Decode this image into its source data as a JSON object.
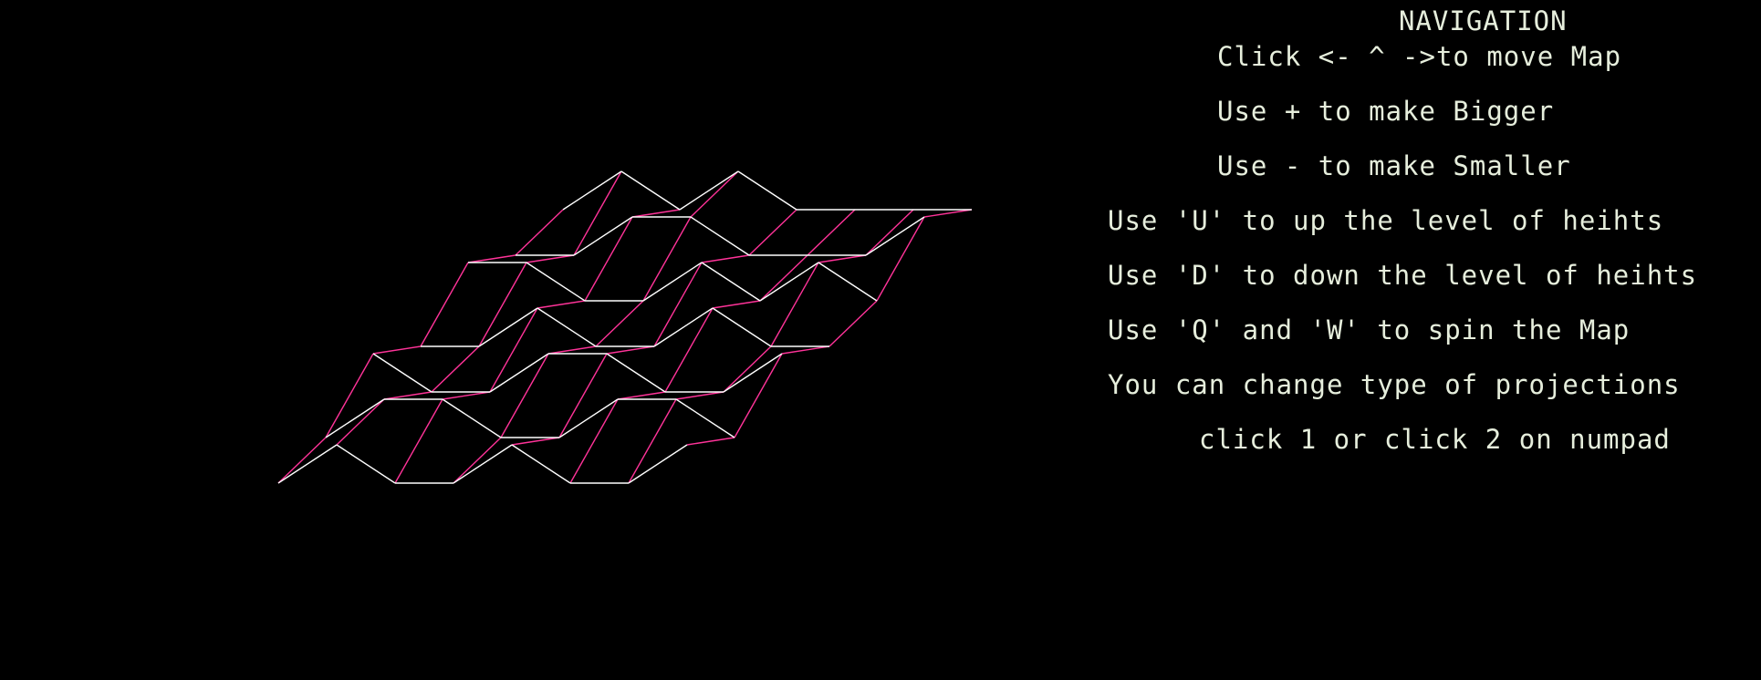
{
  "navigation": {
    "title": "NAVIGATION",
    "lines": [
      "Click <- ^ ->to move Map",
      "Use + to make Bigger",
      "Use - to make Smaller",
      "Use 'U' to up the level of heihts",
      "Use 'D' to down the level of heihts",
      "Use 'Q' and 'W' to spin the Map",
      "You can change type of projections",
      "click 1 or click 2 on numpad"
    ]
  },
  "map": {
    "colors": {
      "background": "#000000",
      "row_edges": "#ffffff",
      "column_edges": "#ff3399",
      "help_text": "#e6eedc"
    },
    "grid_rows": 7,
    "grid_cols": 8,
    "heights": [
      [
        0,
        1,
        0,
        0,
        1,
        0,
        0,
        1
      ],
      [
        0,
        1,
        1,
        0,
        0,
        1,
        1,
        0
      ],
      [
        1,
        0,
        0,
        1,
        1,
        0,
        0,
        1
      ],
      [
        0,
        0,
        1,
        0,
        0,
        1,
        0,
        0
      ],
      [
        1,
        1,
        0,
        0,
        1,
        0,
        1,
        0
      ],
      [
        0,
        0,
        1,
        1,
        0,
        0,
        0,
        1
      ],
      [
        0,
        1,
        0,
        1,
        0,
        0,
        0,
        0
      ]
    ]
  }
}
